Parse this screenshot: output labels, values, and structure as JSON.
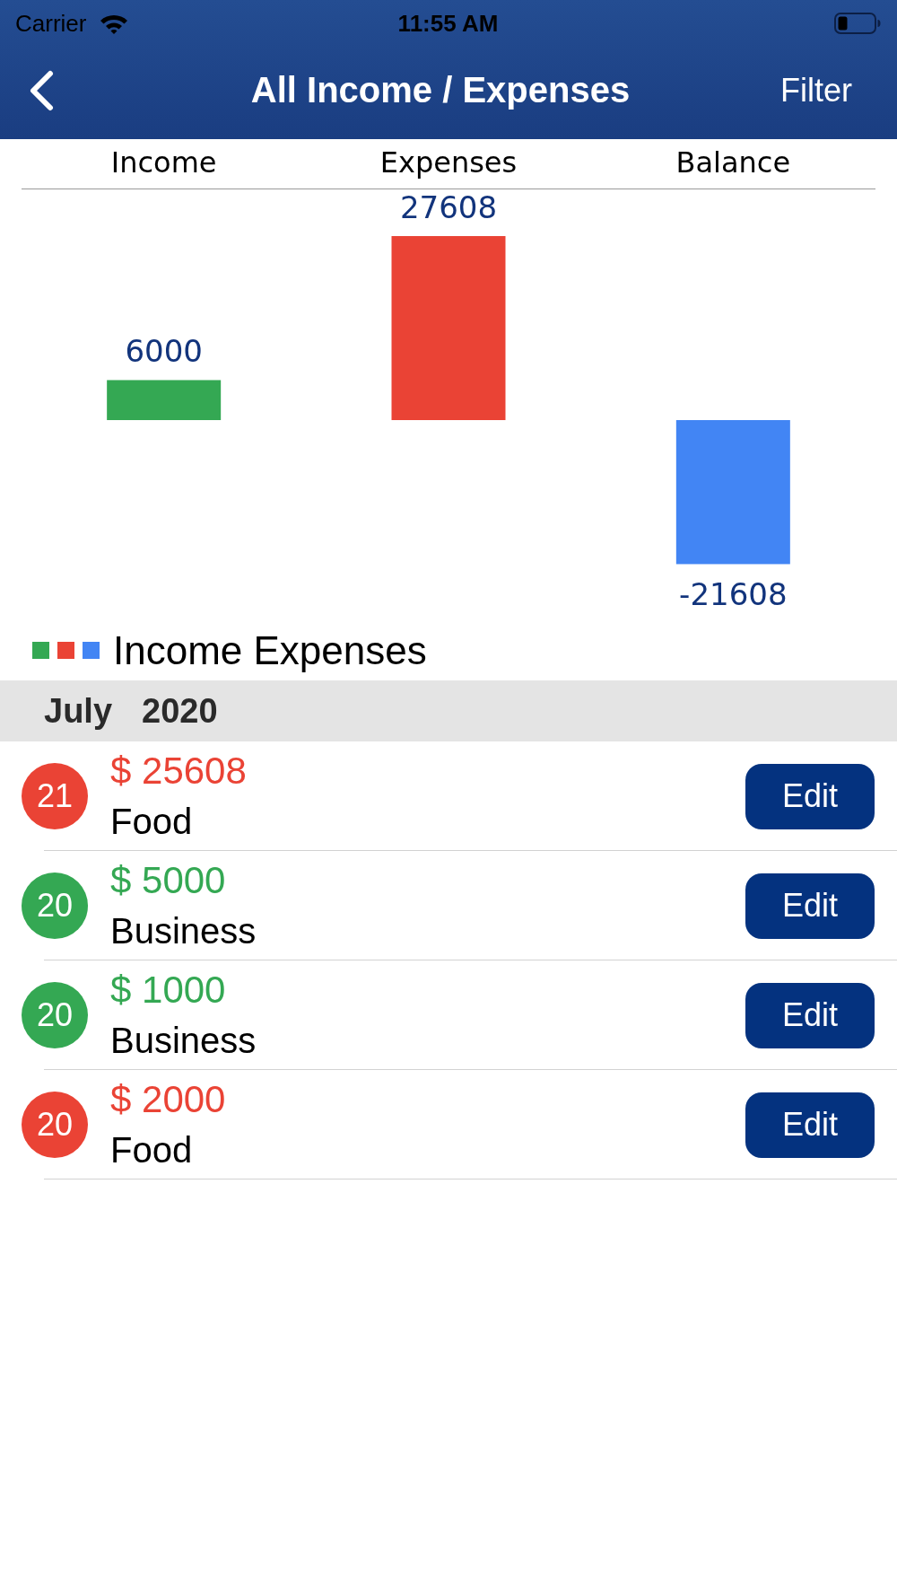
{
  "status_bar": {
    "carrier": "Carrier",
    "time": "11:55 AM"
  },
  "nav_bar": {
    "title": "All Income / Expenses",
    "right_button": "Filter"
  },
  "summary": {
    "chart_data": {
      "type": "bar",
      "categories": [
        "Income",
        "Expenses",
        "Balance"
      ],
      "values": [
        6000,
        27608,
        -21608
      ],
      "data_labels": true
    },
    "legend": {
      "label": "Income Expenses",
      "swatches": [
        {
          "color": "#34a853"
        },
        {
          "color": "#ea4335"
        },
        {
          "color": "#4285f4"
        }
      ]
    }
  },
  "sections": [
    {
      "month": "July",
      "year": "2020",
      "entries": [
        {
          "kind": "expense",
          "day": "21",
          "amount": "$ 25608",
          "category": "Food",
          "button": "Edit"
        },
        {
          "kind": "income",
          "day": "20",
          "amount": "$ 5000",
          "category": "Business",
          "button": "Edit"
        },
        {
          "kind": "income",
          "day": "20",
          "amount": "$ 1000",
          "category": "Business",
          "button": "Edit"
        },
        {
          "kind": "expense",
          "day": "20",
          "amount": "$ 2000",
          "category": "Food",
          "button": "Edit"
        }
      ]
    }
  ]
}
